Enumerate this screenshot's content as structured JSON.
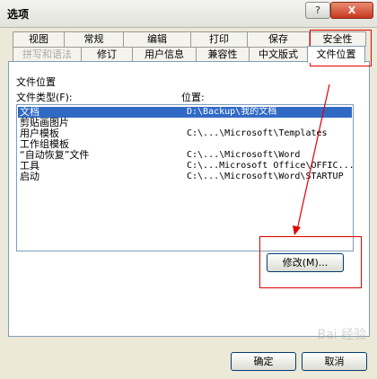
{
  "window": {
    "title": "选项",
    "help_label": "?",
    "close_label": "X"
  },
  "tabs_row1": [
    "视图",
    "常规",
    "编辑",
    "打印",
    "保存",
    "安全性"
  ],
  "tabs_row2": [
    "拼写和语法",
    "修订",
    "用户信息",
    "兼容性",
    "中文版式",
    "文件位置"
  ],
  "section_title": "文件位置",
  "headers": {
    "type": "文件类型(F):",
    "location": "位置:"
  },
  "rows": [
    {
      "type": "文档",
      "location": "D:\\Backup\\我的文档",
      "selected": true
    },
    {
      "type": "剪贴画图片",
      "location": ""
    },
    {
      "type": "用户模板",
      "location": "C:\\...\\Microsoft\\Templates"
    },
    {
      "type": "工作组模板",
      "location": ""
    },
    {
      "type": "“自动恢复”文件",
      "location": "C:\\...\\Microsoft\\Word"
    },
    {
      "type": "工具",
      "location": "C:\\...Microsoft Office\\OFFIC..."
    },
    {
      "type": "启动",
      "location": "C:\\...\\Microsoft\\Word\\STARTUP"
    }
  ],
  "buttons": {
    "modify": "修改(M)...",
    "ok": "确定",
    "cancel": "取消"
  },
  "watermark": "Bai 经验",
  "colors": {
    "selection": "#316ac5",
    "annotation": "#e00000"
  }
}
